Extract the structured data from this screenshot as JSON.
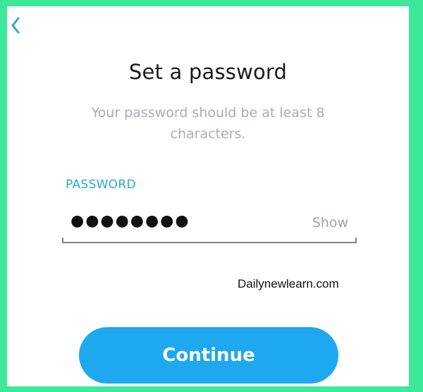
{
  "header": {
    "back_icon": "chevron-left-icon"
  },
  "main": {
    "title": "Set a password",
    "subtitle": "Your password should be at least 8 characters."
  },
  "password_field": {
    "label": "PASSWORD",
    "value_masked": "●●●●●●●●",
    "show_label": "Show"
  },
  "watermark": {
    "text": "Dailynewlearn.com"
  },
  "actions": {
    "continue_label": "Continue"
  },
  "colors": {
    "accent": "#1ea8f0",
    "label_blue": "#2ba7d6",
    "frame_green": "#3ee89a"
  }
}
